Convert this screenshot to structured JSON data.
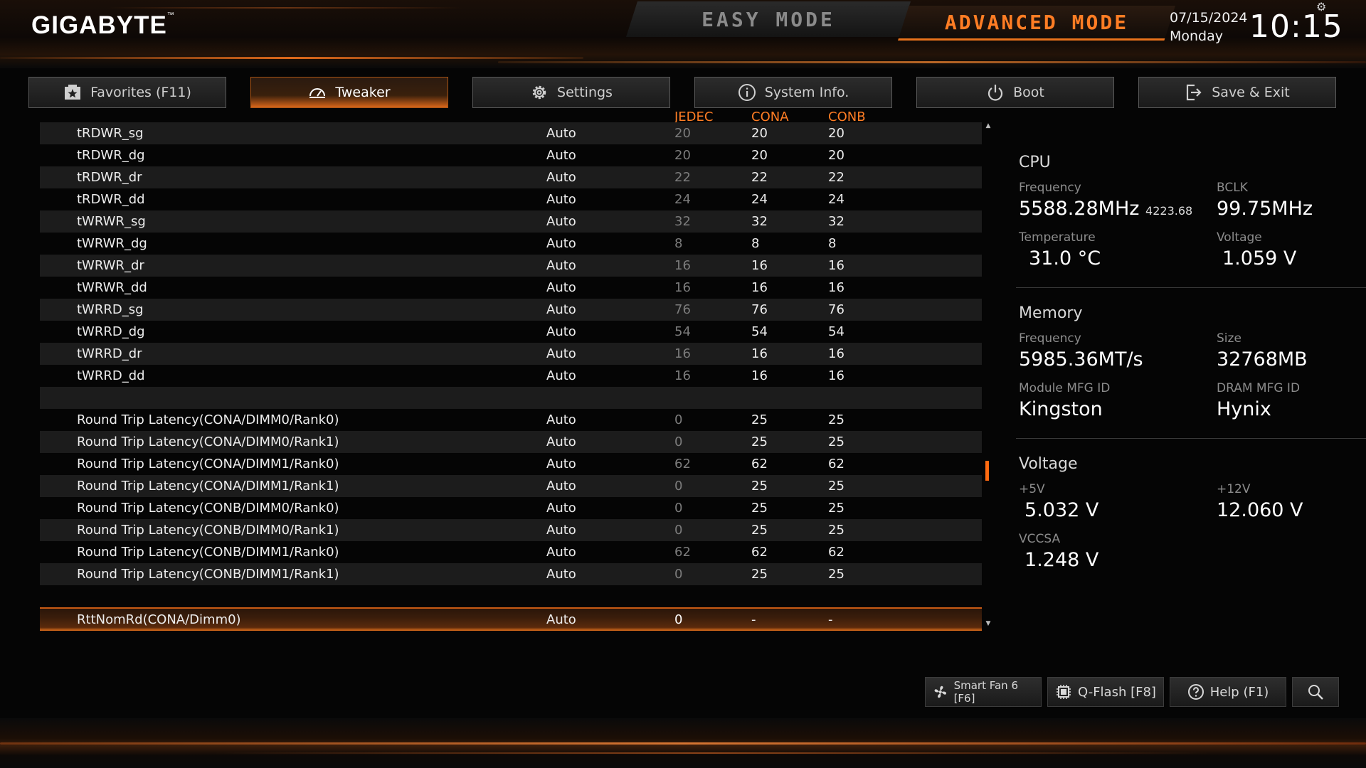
{
  "header": {
    "brand": "GIGABYTE",
    "brand_tm": "™",
    "easy_mode": "EASY MODE",
    "advanced_mode": "ADVANCED MODE",
    "date": "07/15/2024",
    "day": "Monday",
    "time": "10:15",
    "accent_color": "#ff7d24"
  },
  "tabs": [
    {
      "label": "Favorites (F11)",
      "icon": "star-icon"
    },
    {
      "label": "Tweaker",
      "icon": "speedometer-icon",
      "active": true
    },
    {
      "label": "Settings",
      "icon": "gear-icon"
    },
    {
      "label": "System Info.",
      "icon": "info-icon"
    },
    {
      "label": "Boot",
      "icon": "power-icon"
    },
    {
      "label": "Save & Exit",
      "icon": "exit-icon"
    }
  ],
  "columns": {
    "jedec": "JEDEC",
    "cona": "CONA",
    "conb": "CONB"
  },
  "rows": [
    {
      "name": "tRDWR_sg",
      "value": "Auto",
      "jedec": "20",
      "cona": "20",
      "conb": "20"
    },
    {
      "name": "tRDWR_dg",
      "value": "Auto",
      "jedec": "20",
      "cona": "20",
      "conb": "20"
    },
    {
      "name": "tRDWR_dr",
      "value": "Auto",
      "jedec": "22",
      "cona": "22",
      "conb": "22"
    },
    {
      "name": "tRDWR_dd",
      "value": "Auto",
      "jedec": "24",
      "cona": "24",
      "conb": "24"
    },
    {
      "name": "tWRWR_sg",
      "value": "Auto",
      "jedec": "32",
      "cona": "32",
      "conb": "32"
    },
    {
      "name": "tWRWR_dg",
      "value": "Auto",
      "jedec": "8",
      "cona": "8",
      "conb": "8"
    },
    {
      "name": "tWRWR_dr",
      "value": "Auto",
      "jedec": "16",
      "cona": "16",
      "conb": "16"
    },
    {
      "name": "tWRWR_dd",
      "value": "Auto",
      "jedec": "16",
      "cona": "16",
      "conb": "16"
    },
    {
      "name": "tWRRD_sg",
      "value": "Auto",
      "jedec": "76",
      "cona": "76",
      "conb": "76"
    },
    {
      "name": "tWRRD_dg",
      "value": "Auto",
      "jedec": "54",
      "cona": "54",
      "conb": "54"
    },
    {
      "name": "tWRRD_dr",
      "value": "Auto",
      "jedec": "16",
      "cona": "16",
      "conb": "16"
    },
    {
      "name": "tWRRD_dd",
      "value": "Auto",
      "jedec": "16",
      "cona": "16",
      "conb": "16"
    },
    {
      "name": "",
      "value": "",
      "jedec": "",
      "cona": "",
      "conb": ""
    },
    {
      "name": "Round Trip Latency(CONA/DIMM0/Rank0)",
      "value": "Auto",
      "jedec": "0",
      "cona": "25",
      "conb": "25"
    },
    {
      "name": "Round Trip Latency(CONA/DIMM0/Rank1)",
      "value": "Auto",
      "jedec": "0",
      "cona": "25",
      "conb": "25"
    },
    {
      "name": "Round Trip Latency(CONA/DIMM1/Rank0)",
      "value": "Auto",
      "jedec": "62",
      "cona": "62",
      "conb": "62"
    },
    {
      "name": "Round Trip Latency(CONA/DIMM1/Rank1)",
      "value": "Auto",
      "jedec": "0",
      "cona": "25",
      "conb": "25"
    },
    {
      "name": "Round Trip Latency(CONB/DIMM0/Rank0)",
      "value": "Auto",
      "jedec": "0",
      "cona": "25",
      "conb": "25"
    },
    {
      "name": "Round Trip Latency(CONB/DIMM0/Rank1)",
      "value": "Auto",
      "jedec": "0",
      "cona": "25",
      "conb": "25"
    },
    {
      "name": "Round Trip Latency(CONB/DIMM1/Rank0)",
      "value": "Auto",
      "jedec": "62",
      "cona": "62",
      "conb": "62"
    },
    {
      "name": "Round Trip Latency(CONB/DIMM1/Rank1)",
      "value": "Auto",
      "jedec": "0",
      "cona": "25",
      "conb": "25"
    },
    {
      "name": "",
      "value": "",
      "jedec": "",
      "cona": "",
      "conb": ""
    },
    {
      "name": "RttNomRd(CONA/Dimm0)",
      "value": "Auto",
      "jedec": "0",
      "cona": "-",
      "conb": "-",
      "selected": true
    }
  ],
  "cpu": {
    "title": "CPU",
    "freq_label": "Frequency",
    "freq": "5588.28MHz",
    "freq_sub": "4223.68",
    "bclk_label": "BCLK",
    "bclk": "99.75MHz",
    "temp_label": "Temperature",
    "temp": "31.0 °C",
    "volt_label": "Voltage",
    "volt": "1.059 V"
  },
  "memory": {
    "title": "Memory",
    "freq_label": "Frequency",
    "freq": "5985.36MT/s",
    "size_label": "Size",
    "size": "32768MB",
    "mfg_label": "Module MFG ID",
    "mfg": "Kingston",
    "dram_label": "DRAM MFG ID",
    "dram": "Hynix"
  },
  "voltage": {
    "title": "Voltage",
    "v5_label": "+5V",
    "v5": "5.032 V",
    "v12_label": "+12V",
    "v12": "12.060 V",
    "vccsa_label": "VCCSA",
    "vccsa": "1.248 V"
  },
  "bottom": {
    "smartfan": "Smart Fan 6 [F6]",
    "qflash": "Q-Flash [F8]",
    "help": "Help (F1)"
  }
}
